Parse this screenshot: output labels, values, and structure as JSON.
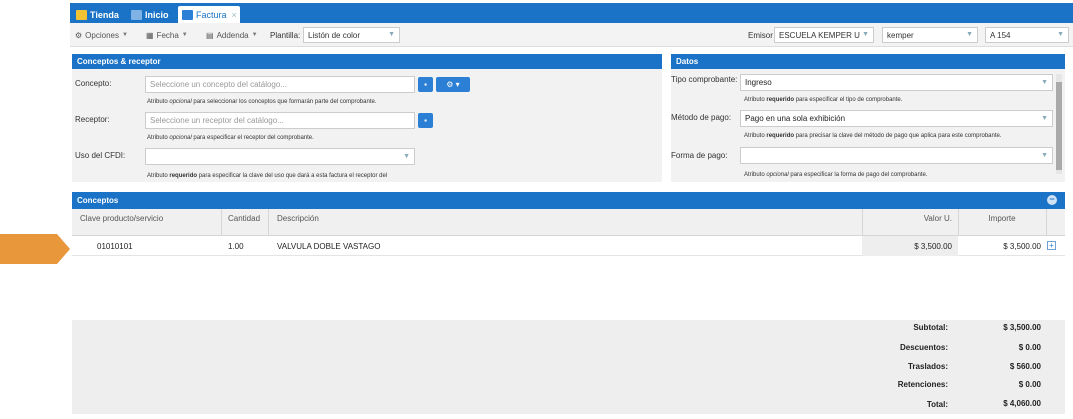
{
  "tabs": [
    {
      "label": "Tienda",
      "active": false
    },
    {
      "label": "Inicio",
      "active": false
    },
    {
      "label": "Factura",
      "active": true
    }
  ],
  "toolbar": {
    "opciones": "Opciones",
    "fecha": "Fecha",
    "addenda": "Addenda",
    "plantilla_label": "Plantilla:",
    "plantilla_value": "Listón de color",
    "emisor_label": "Emisor",
    "emisor_value": "ESCUELA KEMPER U",
    "user_value": "kemper",
    "serie_value": "A 154"
  },
  "conceptos_receptor": {
    "header": "Conceptos & receptor",
    "concepto_label": "Concepto:",
    "concepto_placeholder": "Seleccione un concepto del catálogo...",
    "concepto_hint_a": "Atributo ",
    "concepto_hint_b": "opcional",
    "concepto_hint_c": " para seleccionar los conceptos que formarán parte del comprobante.",
    "receptor_label": "Receptor:",
    "receptor_placeholder": "Seleccione un receptor del catálogo...",
    "receptor_hint_a": "Atributo ",
    "receptor_hint_b": "opcional",
    "receptor_hint_c": " para especificar el receptor del comprobante.",
    "uso_label": "Uso del CFDI:",
    "uso_hint_a": "Atributo ",
    "uso_hint_b": "requerido",
    "uso_hint_c": " para especificar la clave del uso que dará a esta factura el receptor del"
  },
  "datos": {
    "header": "Datos",
    "tipo_label": "Tipo comprobante:",
    "tipo_value": "Ingreso",
    "tipo_hint_a": "Atributo ",
    "tipo_hint_b": "requerido",
    "tipo_hint_c": " para especificar el tipo de comprobante.",
    "metodo_label": "Método de pago:",
    "metodo_value": "Pago en una sola exhibición",
    "metodo_hint_a": "Atributo ",
    "metodo_hint_b": "requerido",
    "metodo_hint_c": " para precisar la clave del método de pago que aplica para este comprobante.",
    "forma_label": "Forma de pago:",
    "forma_hint_a": "Atributo ",
    "forma_hint_b": "opcional",
    "forma_hint_c": " para especificar la forma de pago del comprobante."
  },
  "conceptos": {
    "header": "Conceptos",
    "columns": [
      "Clave producto/servicio",
      "Cantidad",
      "Descripción",
      "Valor U.",
      "Importe"
    ],
    "rows": [
      {
        "clave": "01010101",
        "cantidad": "1.00",
        "descripcion": "VALVULA DOBLE VASTAGO",
        "valor": "$ 3,500.00",
        "importe": "$ 3,500.00"
      }
    ]
  },
  "totals": [
    {
      "label": "Subtotal:",
      "value": "$ 3,500.00"
    },
    {
      "label": "Descuentos:",
      "value": "$ 0.00"
    },
    {
      "label": "Traslados:",
      "value": "$ 560.00"
    },
    {
      "label": "Retenciones:",
      "value": "$ 0.00"
    },
    {
      "label": "Total:",
      "value": "$ 4,060.00"
    }
  ],
  "colors": {
    "brand_blue": "#1a73c7",
    "pointer_orange": "#e8973a"
  }
}
